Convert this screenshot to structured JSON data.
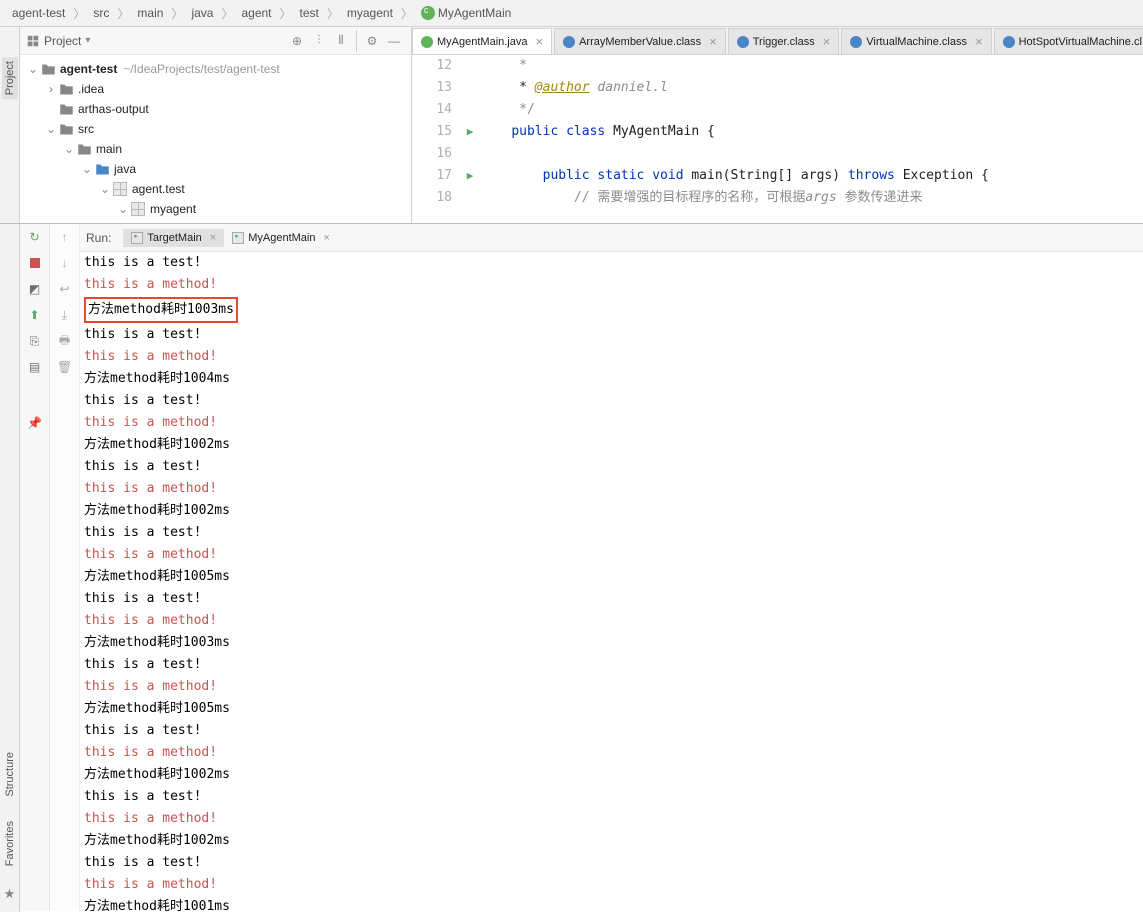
{
  "breadcrumb": [
    "agent-test",
    "src",
    "main",
    "java",
    "agent",
    "test",
    "myagent",
    "MyAgentMain"
  ],
  "project_panel": {
    "title": "Project",
    "toolbar_icons": [
      "target",
      "expand",
      "collapse",
      "divider",
      "gear",
      "hide"
    ]
  },
  "tree": {
    "root": {
      "name": "agent-test",
      "path": "~/IdeaProjects/test/agent-test"
    },
    "children": [
      {
        "indent": 1,
        "arrow": "right",
        "icon": "folder",
        "name": ".idea"
      },
      {
        "indent": 1,
        "arrow": "none",
        "icon": "folder",
        "name": "arthas-output"
      },
      {
        "indent": 1,
        "arrow": "down",
        "icon": "folder",
        "name": "src"
      },
      {
        "indent": 2,
        "arrow": "down",
        "icon": "folder",
        "name": "main"
      },
      {
        "indent": 3,
        "arrow": "down",
        "icon": "folder-blue",
        "name": "java"
      },
      {
        "indent": 4,
        "arrow": "down",
        "icon": "package",
        "name": "agent.test"
      },
      {
        "indent": 5,
        "arrow": "down",
        "icon": "package",
        "name": "myagent"
      }
    ]
  },
  "editor_tabs": [
    {
      "icon": "green",
      "label": "MyAgentMain.java",
      "active": true
    },
    {
      "icon": "blue",
      "label": "ArrayMemberValue.class",
      "active": false
    },
    {
      "icon": "blue",
      "label": "Trigger.class",
      "active": false
    },
    {
      "icon": "blue",
      "label": "VirtualMachine.class",
      "active": false
    },
    {
      "icon": "blue",
      "label": "HotSpotVirtualMachine.cl",
      "active": false
    }
  ],
  "code": {
    "lines": [
      {
        "n": 12,
        "mark": "",
        "kind": "cm",
        "text": " *"
      },
      {
        "n": 13,
        "mark": "",
        "kind": "raw",
        "html": " * <span class='an'>@author</span> <span class='it'>danniel.l</span>"
      },
      {
        "n": 14,
        "mark": "",
        "kind": "cm",
        "text": " */"
      },
      {
        "n": 15,
        "mark": "run",
        "kind": "raw",
        "html": "<span class='kw'>public</span> <span class='kw'>class</span> MyAgentMain {"
      },
      {
        "n": 16,
        "mark": "",
        "kind": "raw",
        "html": ""
      },
      {
        "n": 17,
        "mark": "run",
        "kind": "raw",
        "html": "    <span class='kw'>public</span> <span class='kw'>static</span> <span class='kw'>void</span> main(String[] args) <span class='kw'>throws</span> Exception {"
      },
      {
        "n": 18,
        "mark": "",
        "kind": "raw",
        "html": "        <span class='cm'>// 需要增强的目标程序的名称，可根据<span class='it'>args</span> 参数传递进来</span>"
      }
    ]
  },
  "run": {
    "label": "Run:",
    "tabs": [
      {
        "label": "TargetMain",
        "active": true
      },
      {
        "label": "MyAgentMain",
        "active": false
      }
    ],
    "left_icons": [
      "rerun",
      "up",
      "stop",
      "down",
      "camera",
      "wrap",
      "bug",
      "export",
      "print",
      "trash",
      "layout",
      "",
      "pin"
    ],
    "console": [
      {
        "t": "this is a test!",
        "c": "norm"
      },
      {
        "t": "this is a method!",
        "c": "err"
      },
      {
        "t": "方法method耗时1003ms",
        "c": "norm",
        "hl": true
      },
      {
        "t": "this is a test!",
        "c": "norm"
      },
      {
        "t": "this is a method!",
        "c": "err"
      },
      {
        "t": "方法method耗时1004ms",
        "c": "norm"
      },
      {
        "t": "this is a test!",
        "c": "norm"
      },
      {
        "t": "this is a method!",
        "c": "err"
      },
      {
        "t": "方法method耗时1002ms",
        "c": "norm"
      },
      {
        "t": "this is a test!",
        "c": "norm"
      },
      {
        "t": "this is a method!",
        "c": "err"
      },
      {
        "t": "方法method耗时1002ms",
        "c": "norm"
      },
      {
        "t": "this is a test!",
        "c": "norm"
      },
      {
        "t": "this is a method!",
        "c": "err"
      },
      {
        "t": "方法method耗时1005ms",
        "c": "norm"
      },
      {
        "t": "this is a test!",
        "c": "norm"
      },
      {
        "t": "this is a method!",
        "c": "err"
      },
      {
        "t": "方法method耗时1003ms",
        "c": "norm"
      },
      {
        "t": "this is a test!",
        "c": "norm"
      },
      {
        "t": "this is a method!",
        "c": "err"
      },
      {
        "t": "方法method耗时1005ms",
        "c": "norm"
      },
      {
        "t": "this is a test!",
        "c": "norm"
      },
      {
        "t": "this is a method!",
        "c": "err"
      },
      {
        "t": "方法method耗时1002ms",
        "c": "norm"
      },
      {
        "t": "this is a test!",
        "c": "norm"
      },
      {
        "t": "this is a method!",
        "c": "err"
      },
      {
        "t": "方法method耗时1002ms",
        "c": "norm"
      },
      {
        "t": "this is a test!",
        "c": "norm"
      },
      {
        "t": "this is a method!",
        "c": "err"
      },
      {
        "t": "方法method耗时1001ms",
        "c": "norm"
      }
    ]
  },
  "side_tabs": {
    "top": [
      "Project"
    ],
    "bottom": [
      "Structure",
      "Favorites"
    ]
  }
}
